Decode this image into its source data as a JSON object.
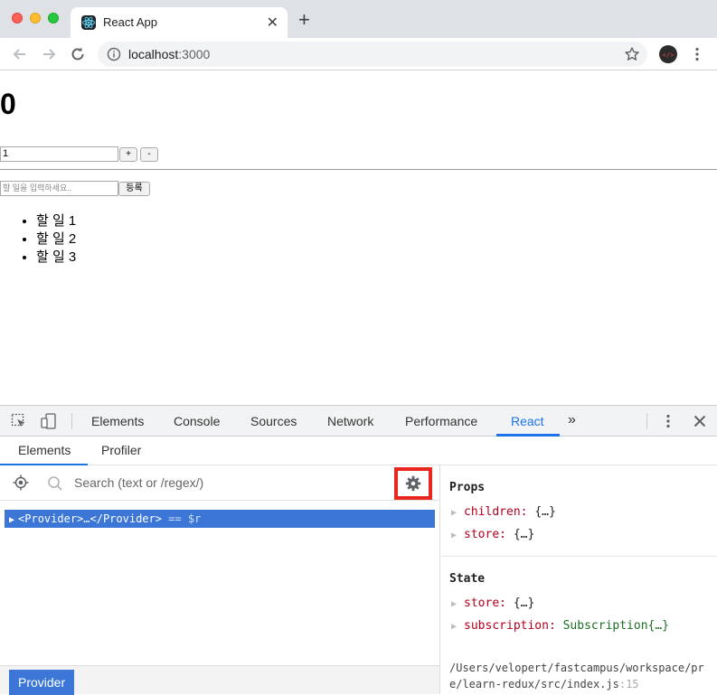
{
  "browser": {
    "tab_title": "React App",
    "tab_close": "✕",
    "new_tab": "+",
    "url_host": "localhost",
    "url_port": ":3000"
  },
  "page": {
    "counter_value": "0",
    "diff_value": "1",
    "plus_label": "+",
    "minus_label": "-",
    "todo_placeholder": "할 일을 입력하세요..",
    "register_label": "등록",
    "todos": [
      "할 일 1",
      "할 일 2",
      "할 일 3"
    ]
  },
  "devtools": {
    "tabs": [
      "Elements",
      "Console",
      "Sources",
      "Network",
      "Performance",
      "React"
    ],
    "active_tab": "React",
    "more": "»",
    "close": "✕",
    "subtabs": [
      "Elements",
      "Profiler"
    ],
    "search_placeholder": "Search (text or /regex/)",
    "tree_row": {
      "arrow": "▶",
      "text": "<Provider>…</Provider>",
      "suffix": " == $r"
    },
    "breadcrumb": "Provider",
    "props_title": "Props",
    "props": [
      {
        "key": "children:",
        "value": "{…}"
      },
      {
        "key": "store:",
        "value": "{…}"
      }
    ],
    "state_title": "State",
    "state": [
      {
        "key": "store:",
        "value": "{…}"
      },
      {
        "key": "subscription:",
        "value": "Subscription{…}"
      }
    ],
    "source_path": "/Users/velopert/fastcampus/workspace/pre/learn-redux/src/index.js",
    "source_line": ":15"
  },
  "colors": {
    "accent": "#1a73e8",
    "selection": "#3c77d8",
    "highlight_box": "#e8261d"
  }
}
